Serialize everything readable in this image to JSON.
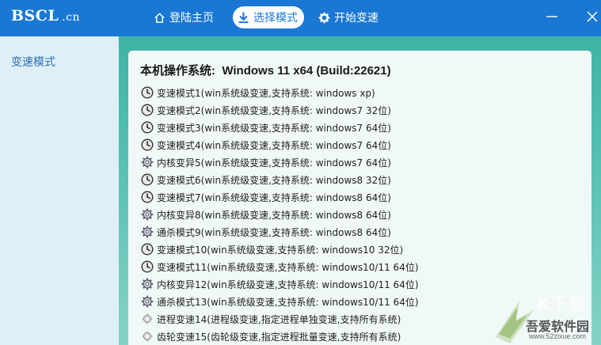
{
  "brand": {
    "name": "BSCL",
    "domain": ".cn"
  },
  "nav": {
    "home": "登陆主页",
    "select": "选择模式",
    "start": "开始变速"
  },
  "colors": {
    "topbar": "#1a78d4",
    "sidebar": "#dfeff6",
    "accent": "#3fb3a5"
  },
  "sidebar": {
    "item": "变速模式"
  },
  "main": {
    "os_label": "本机操作系统:",
    "os_value": "Windows 11 x64 (Build:22621)",
    "modes": [
      {
        "icon": "clock-icon",
        "label": "变速模式1(win系统级变速,支持系统: windows xp)"
      },
      {
        "icon": "clock-icon",
        "label": "变速模式2(win系统级变速,支持系统: windows7 32位)"
      },
      {
        "icon": "clock-icon",
        "label": "变速模式3(win系统级变速,支持系统: windows7 64位)"
      },
      {
        "icon": "clock-icon",
        "label": "变速模式4(win系统级变速,支持系统: windows7 64位)"
      },
      {
        "icon": "gear-icon",
        "label": "内核变异5(win系统级变速,支持系统: windows7 64位)"
      },
      {
        "icon": "clock-icon",
        "label": "变速模式6(win系统级变速,支持系统: windows8 32位)"
      },
      {
        "icon": "clock-icon",
        "label": "变速模式7(win系统级变速,支持系统: windows8 64位)"
      },
      {
        "icon": "gear-icon",
        "label": "内核变异8(win系统级变速,支持系统: windows8 64位)"
      },
      {
        "icon": "gear-icon",
        "label": "通杀模式9(win系统级变速,支持系统: windows8 64位)"
      },
      {
        "icon": "clock-icon",
        "label": "变速模式10(win系统级变速,支持系统: windows10 32位)"
      },
      {
        "icon": "clock-icon",
        "label": "变速模式11(win系统级变速,支持系统: windows10/11 64位)"
      },
      {
        "icon": "gear-icon",
        "label": "内核变异12(win系统级变速,支持系统: windows10/11 64位)"
      },
      {
        "icon": "gear-icon",
        "label": "通杀模式13(win系统级变速,支持系统: windows10/11 64位)"
      },
      {
        "icon": "process-icon",
        "label": "进程变速14(进程级变速,指定进程单独变速,支持所有系统)"
      },
      {
        "icon": "process-icon",
        "label": "齿轮变速15(齿轮级变速,指定进程批量变速,支持所有系统)"
      }
    ]
  },
  "watermark": {
    "name": "吾爱软件园",
    "url": "www.52zixue.com"
  }
}
